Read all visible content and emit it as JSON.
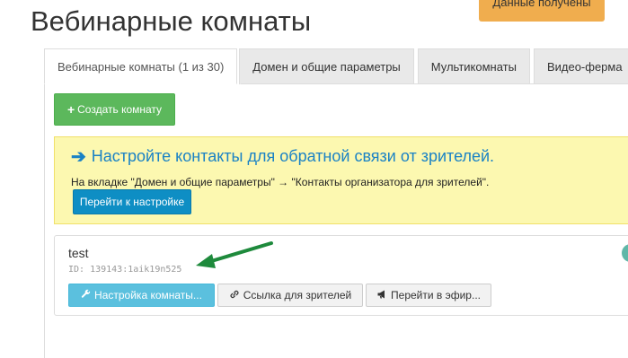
{
  "page": {
    "title": "Вебинарные комнаты"
  },
  "toast": {
    "text": "Данные получены",
    "color": "#f0ad4e"
  },
  "tabs": [
    {
      "label": "Вебинарные комнаты (1 из 30)",
      "active": true
    },
    {
      "label": "Домен и общие параметры",
      "active": false
    },
    {
      "label": "Мультикомнаты",
      "active": false
    },
    {
      "label": "Видео-ферма",
      "active": false
    }
  ],
  "toolbar": {
    "create_icon": "plus-icon",
    "create_label": "Создать комнату"
  },
  "alert": {
    "icon": "arrow-right-icon",
    "title": "Настройте контакты для обратной связи от зрителей.",
    "text": "На вкладке \"Домен и общие параметры\" → \"Контакты организатора для зрителей\".",
    "button_label": "Перейти к настройке"
  },
  "room": {
    "name": "test",
    "id_text": "ID: 139143:1aik19n525",
    "settings_icon": "wrench-icon",
    "settings_label": "Настройка комнаты...",
    "link_icon": "link-icon",
    "link_label": "Ссылка для зрителей",
    "live_icon": "megaphone-icon",
    "live_label": "Перейти в эфир..."
  },
  "colors": {
    "create_button": "#5cb85c",
    "alert_background": "#fcf8b0",
    "alert_title": "#1a82c5",
    "setup_button": "#0e8ec4",
    "settings_button": "#5bc0de",
    "annotation_arrow": "#1e8a3c",
    "status_dot": "#5fb7a8"
  }
}
